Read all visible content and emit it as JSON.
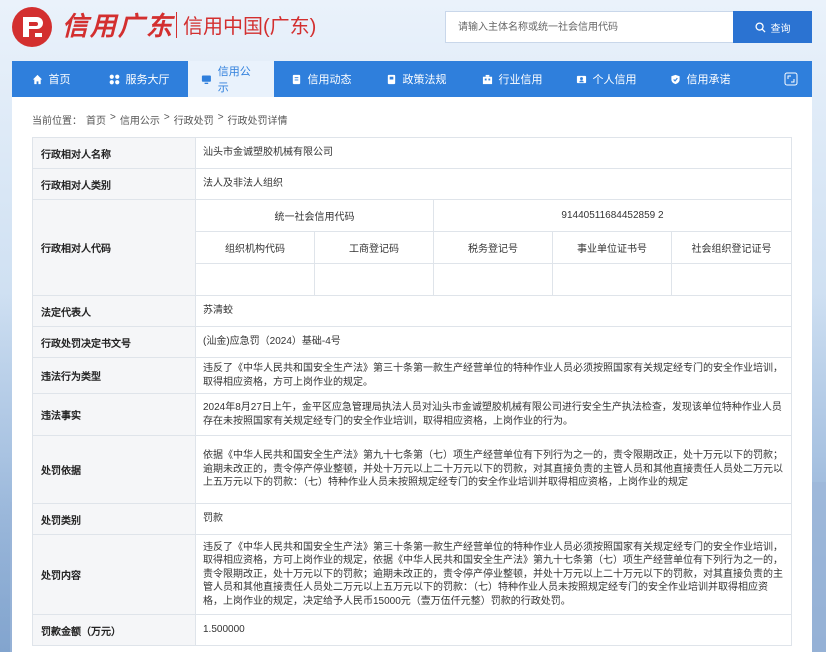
{
  "header": {
    "logo_calligraphy": "信用广东",
    "logo_title": "信用中国(广东)",
    "search_placeholder": "请输入主体名称或统一社会信用代码",
    "search_button": "查询"
  },
  "nav": {
    "items": [
      {
        "label": "首页",
        "icon": "home-icon"
      },
      {
        "label": "服务大厅",
        "icon": "grid-icon"
      },
      {
        "label": "信用公示",
        "icon": "monitor-icon",
        "active": true
      },
      {
        "label": "信用动态",
        "icon": "document-icon"
      },
      {
        "label": "政策法规",
        "icon": "book-icon"
      },
      {
        "label": "行业信用",
        "icon": "building-icon"
      },
      {
        "label": "个人信用",
        "icon": "id-card-icon"
      },
      {
        "label": "信用承诺",
        "icon": "shield-icon"
      }
    ],
    "expand_icon": "expand-icon"
  },
  "breadcrumb": {
    "prefix": "当前位置：",
    "items": [
      "首页",
      "信用公示",
      "行政处罚",
      "行政处罚详情"
    ],
    "separator": ">"
  },
  "detail": {
    "name_label": "行政相对人名称",
    "name_value": "汕头市金诚塑胶机械有限公司",
    "category_label": "行政相对人类别",
    "category_value": "法人及非法人组织",
    "code_label": "行政相对人代码",
    "uscc_label": "统一社会信用代码",
    "uscc_value": "91440511684452859 2",
    "sub_headers": [
      "组织机构代码",
      "工商登记码",
      "税务登记号",
      "事业单位证书号",
      "社会组织登记证号"
    ],
    "legal_rep_label": "法定代表人",
    "legal_rep_value": "苏清蛟",
    "doc_no_label": "行政处罚决定书文号",
    "doc_no_value": "(汕金)应急罚（2024）基础-4号",
    "violation_type_label": "违法行为类型",
    "violation_type_value": "违反了《中华人民共和国安全生产法》第三十条第一款生产经营单位的特种作业人员必须按照国家有关规定经专门的安全作业培训，取得相应资格，方可上岗作业的规定。",
    "facts_label": "违法事实",
    "facts_value": "2024年8月27日上午，金平区应急管理局执法人员对汕头市金诚塑胶机械有限公司进行安全生产执法检查，发现该单位特种作业人员存在未按照国家有关规定经专门的安全作业培训，取得相应资格，上岗作业的行为。",
    "basis_label": "处罚依据",
    "basis_value": "依据《中华人民共和国安全生产法》第九十七条第（七）项生产经营单位有下列行为之一的，责令限期改正，处十万元以下的罚款；逾期未改正的，责令停产停业整顿，并处十万元以上二十万元以下的罚款，对其直接负责的主管人员和其他直接责任人员处二万元以上五万元以下的罚款：（七）特种作业人员未按照规定经专门的安全作业培训并取得相应资格，上岗作业的规定",
    "penalty_type_label": "处罚类别",
    "penalty_type_value": "罚款",
    "content_label": "处罚内容",
    "content_value": "违反了《中华人民共和国安全生产法》第三十条第一款生产经营单位的特种作业人员必须按照国家有关规定经专门的安全作业培训，取得相应资格，方可上岗作业的规定，依据《中华人民共和国安全生产法》第九十七条第（七）项生产经营单位有下列行为之一的，责令限期改正，处十万元以下的罚款；逾期未改正的，责令停产停业整顿，并处十万元以上二十万元以下的罚款，对其直接负责的主管人员和其他直接责任人员处二万元以上五万元以下的罚款：（七）特种作业人员未按照规定经专门的安全作业培训并取得相应资格，上岗作业的规定，决定给予人民币15000元（壹万伍仟元整）罚款的行政处罚。",
    "amount_label": "罚款金额（万元）",
    "amount_value": "1.500000"
  },
  "colors": {
    "brand_red": "#d32f2f",
    "nav_blue": "#2f7fdc",
    "button_blue": "#2b73d2"
  }
}
